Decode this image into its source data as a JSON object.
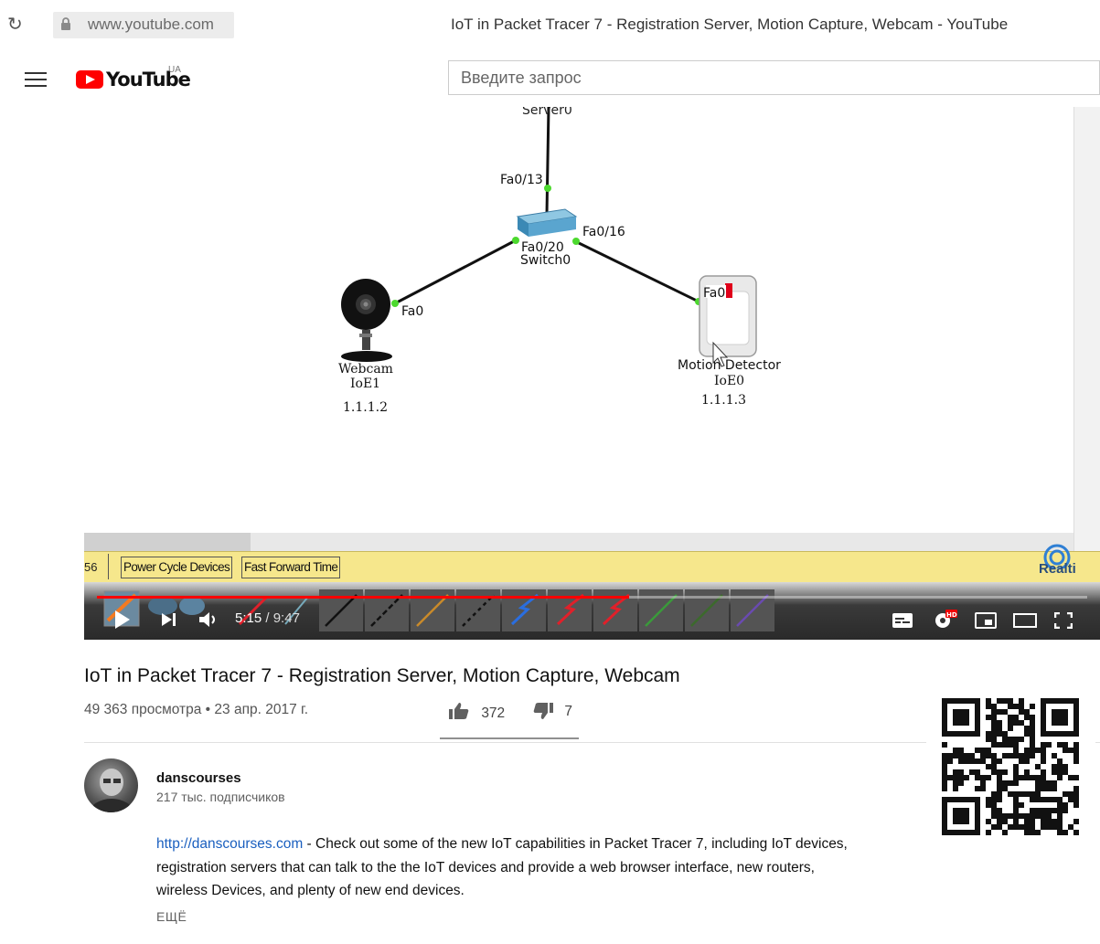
{
  "browser": {
    "reload_icon": "reload-icon",
    "url": "www.youtube.com",
    "page_title": "IoT in Packet Tracer 7 - Registration Server, Motion Capture, Webcam - YouTube"
  },
  "header": {
    "logo_text": "YouTube",
    "region": "UA",
    "search_placeholder": "Введите запрос"
  },
  "video": {
    "time_current": "5:15",
    "time_total": "9:47",
    "progress": 0.537,
    "packet_tracer": {
      "toolbar_number": "56",
      "power_cycle_label": "Power Cycle Devices",
      "fast_forward_label": "Fast Forward Time",
      "realtime_label": "Realti",
      "server_label": "Server0",
      "switch": {
        "name": "Switch0",
        "port_top": "Fa0/13",
        "port_left": "Fa0/20",
        "port_right": "Fa0/16"
      },
      "webcam": {
        "port": "Fa0",
        "type": "Webcam",
        "name": "IoE1",
        "ip": "1.1.1.2"
      },
      "motion": {
        "port": "Fa0",
        "type": "Motion Detector",
        "name": "IoE0",
        "ip": "1.1.1.3"
      }
    }
  },
  "info": {
    "title": "IoT in Packet Tracer 7 - Registration Server, Motion Capture, Webcam",
    "views": "49 363 просмотра",
    "separator": " • ",
    "date": "23 апр. 2017 г.",
    "likes": "372",
    "dislikes": "7",
    "like_ratio": 0.98
  },
  "channel": {
    "name": "danscourses",
    "subscribers": "217 тыс. подписчиков"
  },
  "description": {
    "link": "http://danscourses.com",
    "text": " - Check out some of the new IoT capabilities in Packet Tracer 7, including IoT devices, registration servers that can talk to the the IoT devices and provide a web browser interface, new routers, wireless Devices, and plenty of new end devices.",
    "more_label": "ЕЩЁ"
  },
  "colors": {
    "youtube_red": "#ff0000",
    "link_blue": "#1a5fbf",
    "pt_toolbar": "#f6e78c"
  }
}
